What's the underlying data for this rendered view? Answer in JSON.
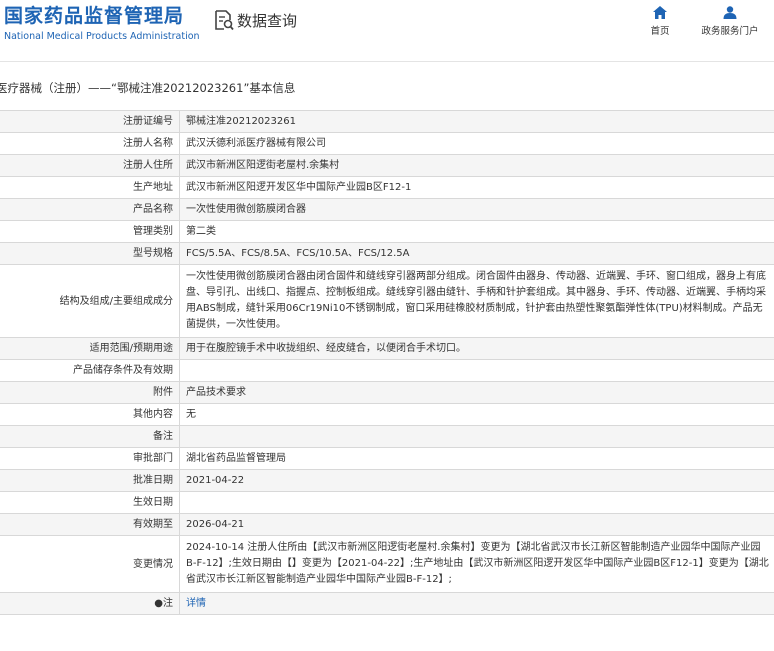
{
  "header": {
    "brand_cn": "国家药品监督管理局",
    "brand_en": "National Medical Products Administration",
    "query_label": "数据查询",
    "nav": [
      {
        "label": "首页",
        "icon": "home-icon"
      },
      {
        "label": "政务服务门户",
        "icon": "user-icon"
      }
    ]
  },
  "page": {
    "title": "医疗器械（注册）——“鄂械注准20212023261”基本信息"
  },
  "table": {
    "rows": [
      {
        "label": "注册证编号",
        "value": "鄂械注准20212023261"
      },
      {
        "label": "注册人名称",
        "value": "武汉沃德利派医疗器械有限公司"
      },
      {
        "label": "注册人住所",
        "value": "武汉市新洲区阳逻街老屋村.余集村"
      },
      {
        "label": "生产地址",
        "value": "武汉市新洲区阳逻开发区华中国际产业园B区F12-1"
      },
      {
        "label": "产品名称",
        "value": "一次性使用微创筋膜闭合器"
      },
      {
        "label": "管理类别",
        "value": "第二类"
      },
      {
        "label": "型号规格",
        "value": "FCS/5.5A、FCS/8.5A、FCS/10.5A、FCS/12.5A"
      },
      {
        "label": "结构及组成/主要组成成分",
        "value": "一次性使用微创筋膜闭合器由闭合固件和缝线穿引器两部分组成。闭合固件由器身、传动器、近端翼、手环、窗口组成，器身上有底盘、导引孔、出线口、指握点、控制板组成。缝线穿引器由缝针、手柄和针护套组成。其中器身、手环、传动器、近端翼、手柄均采用ABS制成，缝针采用06Cr19Ni10不锈钢制成，窗口采用硅橡胶材质制成，针护套由热塑性聚氨酯弹性体(TPU)材料制成。产品无菌提供，一次性使用。"
      },
      {
        "label": "适用范围/预期用途",
        "value": "用于在腹腔镜手术中收拢组织、经皮缝合，以便闭合手术切口。"
      },
      {
        "label": "产品储存条件及有效期",
        "value": ""
      },
      {
        "label": "附件",
        "value": "产品技术要求"
      },
      {
        "label": "其他内容",
        "value": "无"
      },
      {
        "label": "备注",
        "value": ""
      },
      {
        "label": "审批部门",
        "value": "湖北省药品监督管理局"
      },
      {
        "label": "批准日期",
        "value": "2021-04-22"
      },
      {
        "label": "生效日期",
        "value": ""
      },
      {
        "label": "有效期至",
        "value": "2026-04-21"
      },
      {
        "label": "变更情况",
        "value": "2024-10-14 注册人住所由【武汉市新洲区阳逻街老屋村.余集村】变更为【湖北省武汉市长江新区智能制造产业园华中国际产业园B-F-12】;生效日期由【】变更为【2021-04-22】;生产地址由【武汉市新洲区阳逻开发区华中国际产业园B区F12-1】变更为【湖北省武汉市长江新区智能制造产业园华中国际产业园B-F-12】;"
      },
      {
        "label": "●注",
        "value": "详情"
      }
    ]
  },
  "colors": {
    "brand_blue": "#1e64b4",
    "row_odd": "#f5f5f5",
    "border": "#d8d8d8"
  }
}
